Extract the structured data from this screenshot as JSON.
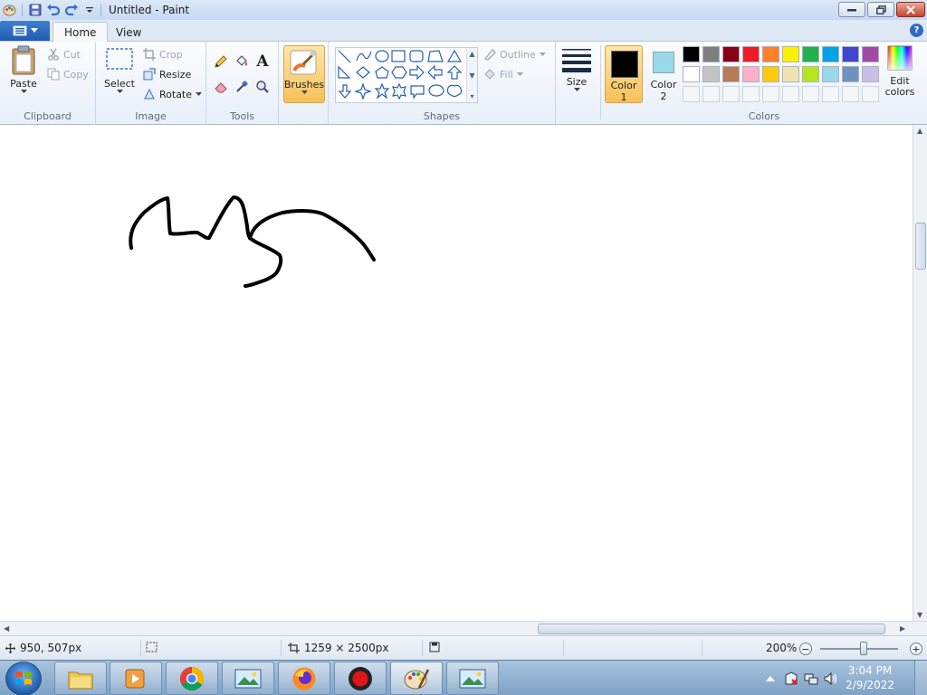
{
  "window": {
    "title": "Untitled - Paint"
  },
  "tabs": {
    "home": "Home",
    "view": "View"
  },
  "clipboard": {
    "label": "Clipboard",
    "paste": "Paste",
    "cut": "Cut",
    "copy": "Copy"
  },
  "image": {
    "label": "Image",
    "select": "Select",
    "crop": "Crop",
    "resize": "Resize",
    "rotate": "Rotate"
  },
  "tools": {
    "label": "Tools",
    "text_glyph": "A"
  },
  "brushes": {
    "label": "Brushes"
  },
  "shapes": {
    "label": "Shapes",
    "outline": "Outline",
    "fill": "Fill"
  },
  "size": {
    "label": "Size"
  },
  "colors": {
    "label": "Colors",
    "color1_label": "Color",
    "color1_num": "1",
    "color2_label": "Color",
    "color2_num": "2",
    "edit_label": "Edit",
    "edit_label2": "colors",
    "color1": "#000000",
    "color2": "#99d9ea",
    "palette": [
      "#000000",
      "#7f7f7f",
      "#880015",
      "#ed1c24",
      "#ff7f27",
      "#fff200",
      "#22b14c",
      "#00a2e8",
      "#3f48cc",
      "#a349a4",
      "#ffffff",
      "#c3c3c3",
      "#b97a57",
      "#ffaec9",
      "#ffc90e",
      "#efe4b0",
      "#b5e61d",
      "#99d9ea",
      "#7092be",
      "#c8bfe7"
    ],
    "custom_slots": 10
  },
  "status": {
    "cursor_pos": "950, 507px",
    "canvas_size": "1259 × 2500px",
    "zoom": "200%",
    "zoom_level": 0.56
  },
  "taskbar": {
    "time": "3:04 PM",
    "date": "2/9/2022"
  }
}
